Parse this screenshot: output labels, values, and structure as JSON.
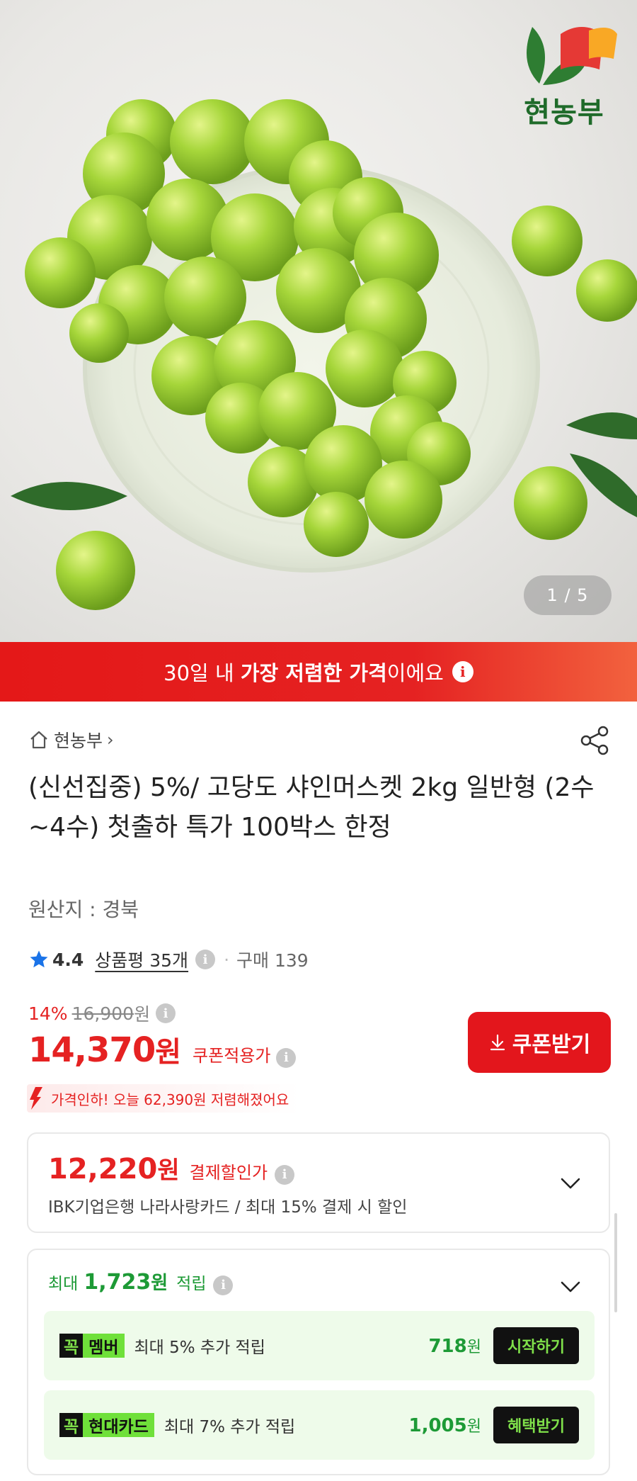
{
  "hero": {
    "image_counter": "1 / 5",
    "brand_logo_text": "현농부"
  },
  "banner": {
    "text_pre": "30일 내 ",
    "text_bold": "가장 저렴한 가격",
    "text_post": "이에요",
    "info_glyph": "i"
  },
  "store": {
    "name": "현농부",
    "chevron": "›"
  },
  "product": {
    "title": "(신선집중) 5%/ 고당도 샤인머스켓 2kg 일반형 (2수~4수) 첫출하 특가 100박스 한정",
    "origin": "원산지 : 경북"
  },
  "rating": {
    "score": "4.4",
    "reviews": "상품평 35개",
    "separator": "·",
    "purchases": "구매 139"
  },
  "pricing": {
    "discount_pct": "14%",
    "original_price": "16,900",
    "original_won": "원",
    "price": "14,370",
    "price_won": "원",
    "coupon_label": "쿠폰적용가",
    "coupon_button": "쿠폰받기",
    "price_drop": "가격인하! 오늘 62,390원 저렴해졌어요"
  },
  "payment_discount": {
    "amount": "12,220",
    "won": "원",
    "label": "결제할인가",
    "description": "IBK기업은행 나라사랑카드 / 최대 15% 결제 시 할인"
  },
  "rewards": {
    "prefix": "최대",
    "amount": "1,723",
    "won": "원",
    "suffix": "적립",
    "items": [
      {
        "badge_k": "꼭",
        "badge_name": "멤버",
        "description": "최대 5% 추가 적립",
        "amount": "718",
        "won": "원",
        "button": "시작하기"
      },
      {
        "badge_k": "꼭",
        "badge_name": "현대카드",
        "description": "최대 7% 추가 적립",
        "amount": "1,005",
        "won": "원",
        "button": "혜택받기"
      }
    ]
  },
  "colors": {
    "accent_red": "#e52222",
    "reward_green": "#1d9a36",
    "badge_green": "#6fe03a",
    "grape_green": "#9fd33a"
  },
  "icons": [
    "home-icon",
    "share-icon",
    "star-icon",
    "info-icon",
    "download-icon",
    "chevron-down-icon",
    "price-drop-arrow-icon",
    "brand-logo"
  ]
}
